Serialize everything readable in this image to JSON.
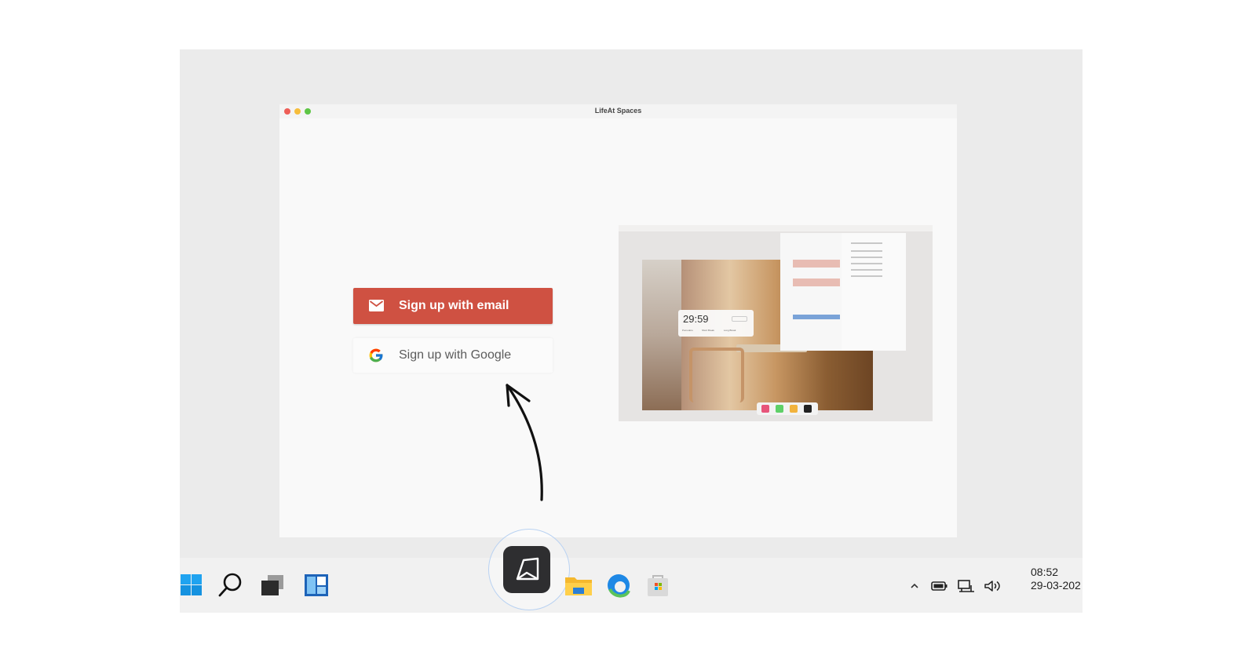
{
  "window": {
    "title": "LifeAt Spaces"
  },
  "signup": {
    "email_label": "Sign up with email",
    "google_label": "Sign up with Google",
    "email_button_color": "#cf5142"
  },
  "preview": {
    "timer_value": "29:59",
    "timer_tabs": [
      "Pomodoro",
      "Short Break",
      "Long Break"
    ]
  },
  "taskbar": {
    "icons": [
      "windows-start-icon",
      "search-icon",
      "task-view-icon",
      "widgets-icon",
      "lifeat-app-icon",
      "file-explorer-icon",
      "edge-browser-icon",
      "store-icon"
    ],
    "tray": [
      "chevron-up-icon",
      "battery-icon",
      "network-icon",
      "volume-icon"
    ],
    "clock_time": "08:52",
    "clock_date": "29-03-202"
  }
}
